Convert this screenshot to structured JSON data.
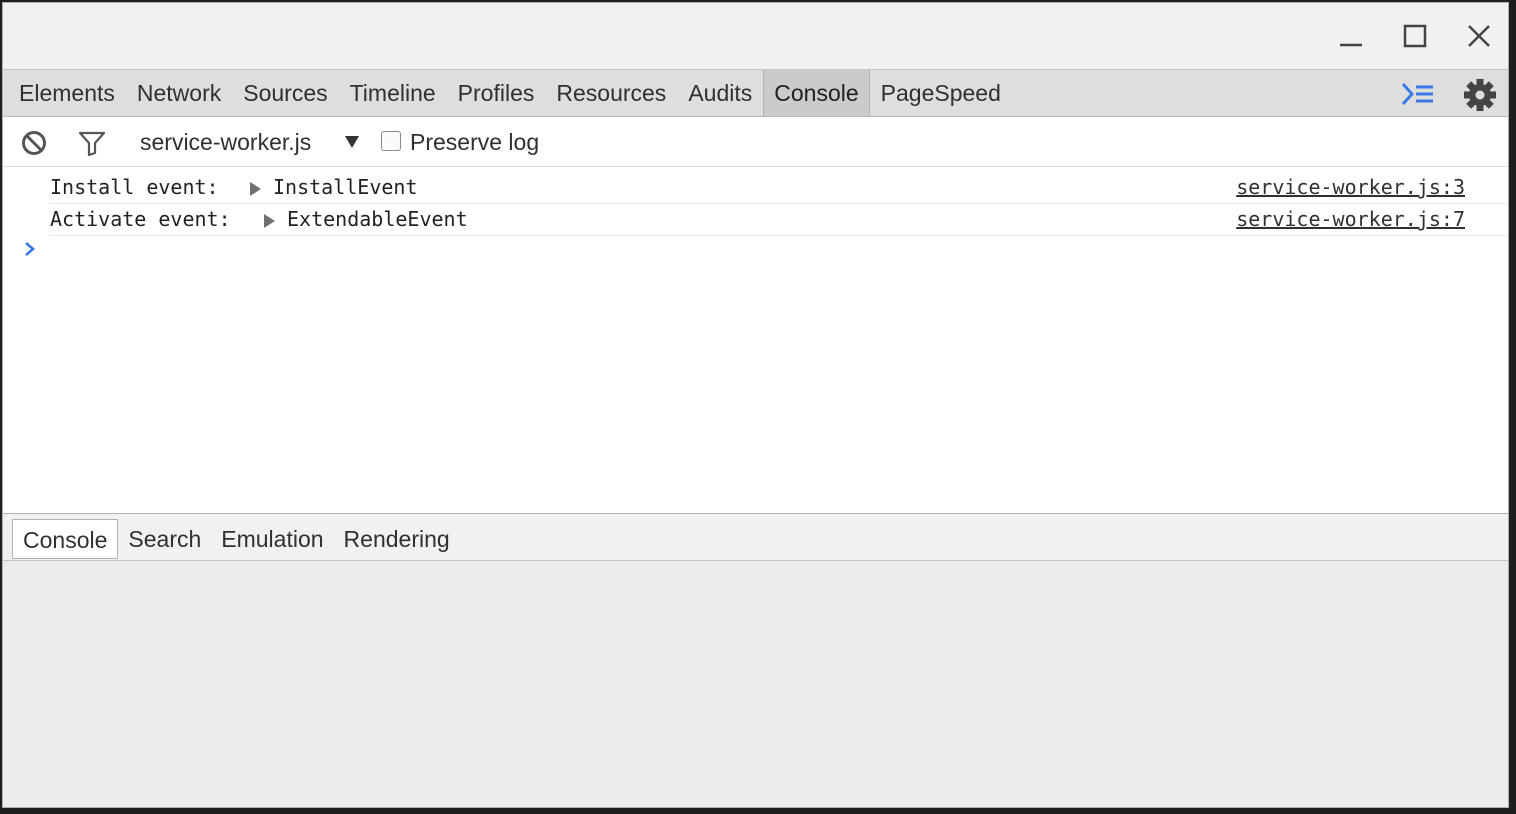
{
  "window": {
    "controls": {
      "minimize": "minimize-icon",
      "maximize": "maximize-icon",
      "close": "close-icon"
    }
  },
  "panel_tabs": [
    {
      "label": "Elements"
    },
    {
      "label": "Network"
    },
    {
      "label": "Sources"
    },
    {
      "label": "Timeline"
    },
    {
      "label": "Profiles"
    },
    {
      "label": "Resources"
    },
    {
      "label": "Audits"
    },
    {
      "label": "Console",
      "active": true
    },
    {
      "label": "PageSpeed"
    }
  ],
  "toolbar": {
    "context": "service-worker.js",
    "preserve_log_label": "Preserve log",
    "preserve_log_checked": false
  },
  "console": {
    "messages": [
      {
        "label": "Install event: ",
        "object": "InstallEvent",
        "source": "service-worker.js:3"
      },
      {
        "label": "Activate event: ",
        "object": "ExtendableEvent",
        "source": "service-worker.js:7"
      }
    ]
  },
  "drawer": {
    "tabs": [
      {
        "label": "Console",
        "active": true
      },
      {
        "label": "Search"
      },
      {
        "label": "Emulation"
      },
      {
        "label": "Rendering"
      }
    ]
  },
  "colors": {
    "accent": "#3b78e7",
    "active_tab": "#cbcbcb"
  }
}
